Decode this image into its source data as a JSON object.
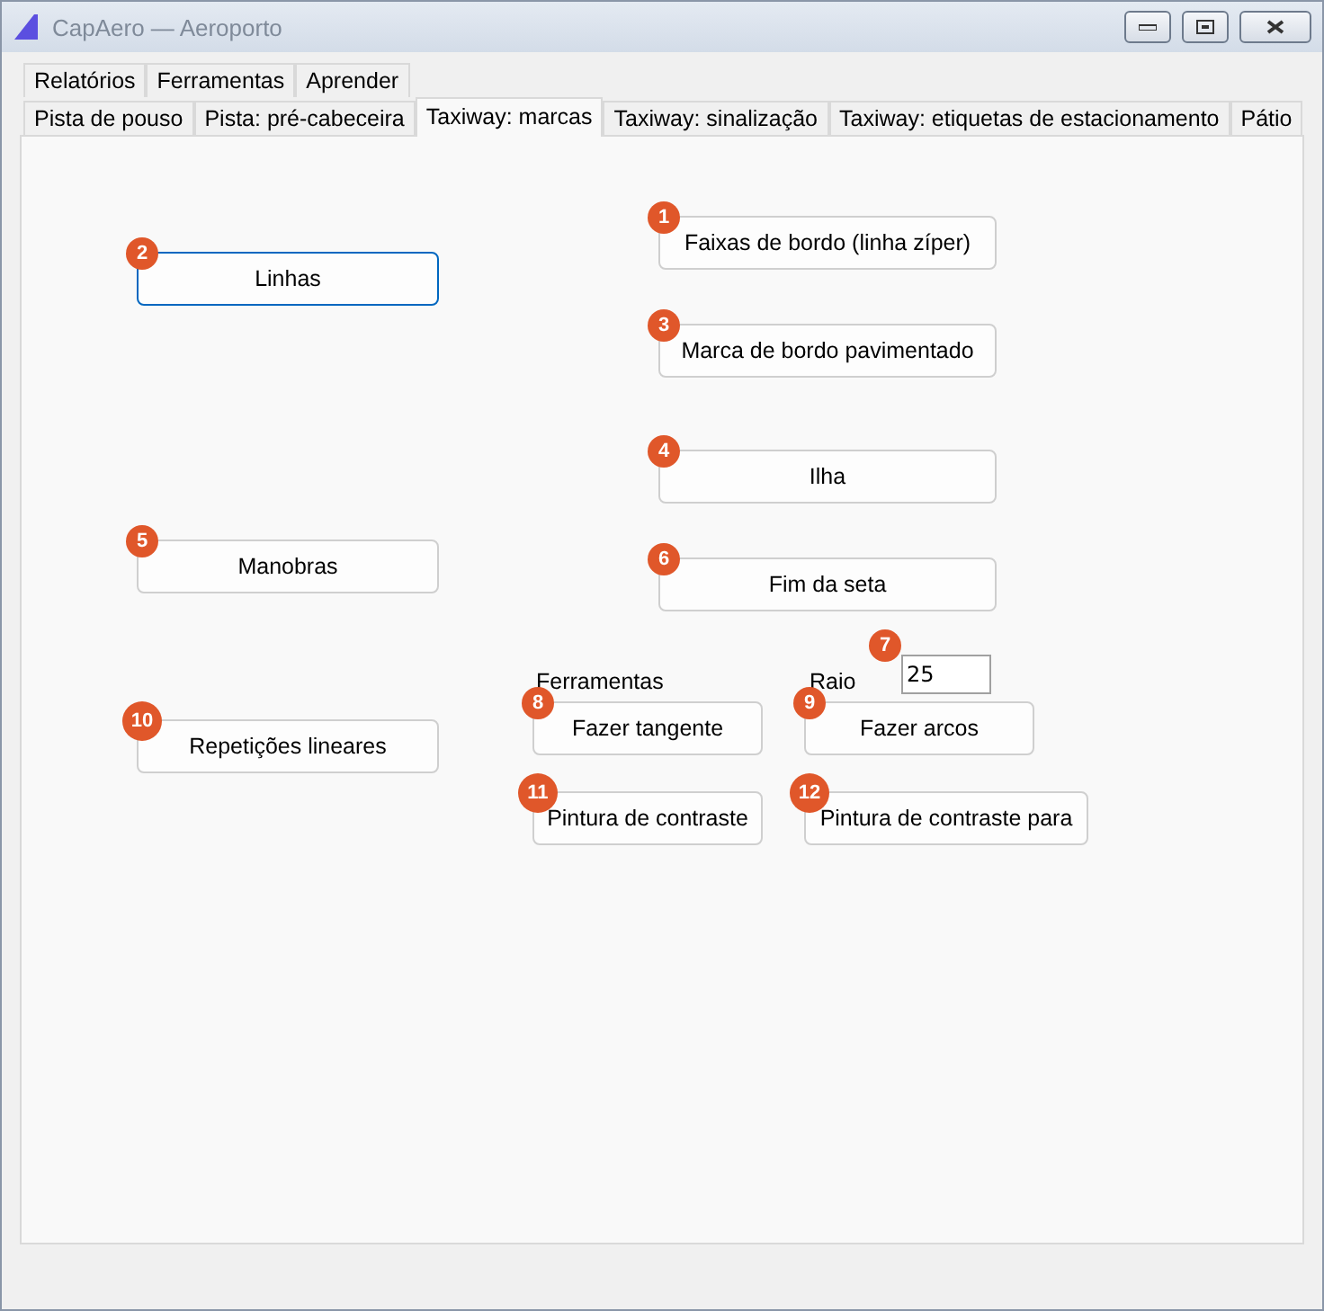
{
  "window": {
    "title": "CapAero — Aeroporto"
  },
  "tab_rows": [
    [
      {
        "label": "Relatórios",
        "selected": false
      },
      {
        "label": "Ferramentas",
        "selected": false
      },
      {
        "label": "Aprender",
        "selected": false
      }
    ],
    [
      {
        "label": "Pista de pouso",
        "selected": false
      },
      {
        "label": "Pista: pré-cabeceira",
        "selected": false
      },
      {
        "label": "Taxiway: marcas",
        "selected": true
      },
      {
        "label": "Taxiway: sinalização",
        "selected": false
      },
      {
        "label": "Taxiway: etiquetas de estacionamento",
        "selected": false
      },
      {
        "label": "Pátio",
        "selected": false
      }
    ]
  ],
  "left_buttons": [
    {
      "label": "Linhas",
      "badge": "2",
      "focused": true
    },
    {
      "label": "Manobras",
      "badge": "5",
      "focused": false
    },
    {
      "label": "Repetições lineares",
      "badge": "10",
      "focused": false
    }
  ],
  "right_buttons": [
    {
      "label": "Faixas de bordo (linha zíper)",
      "badge": "1",
      "focused": false
    },
    {
      "label": "Marca de bordo pavimentado",
      "badge": "3",
      "focused": false
    },
    {
      "label": "Ilha",
      "badge": "4",
      "focused": false
    },
    {
      "label": "Fim da seta",
      "badge": "6",
      "focused": false
    }
  ],
  "tools": {
    "label": "Ferramentas",
    "radius_label": "Raio",
    "radius_field": {
      "value": "25",
      "badge": "7"
    },
    "buttons": [
      {
        "label": "Fazer tangente",
        "badge": "8"
      },
      {
        "label": "Fazer arcos",
        "badge": "9"
      },
      {
        "label": "Pintura de contraste",
        "badge": "11"
      },
      {
        "label": "Pintura de contraste para",
        "badge": "12"
      }
    ]
  }
}
